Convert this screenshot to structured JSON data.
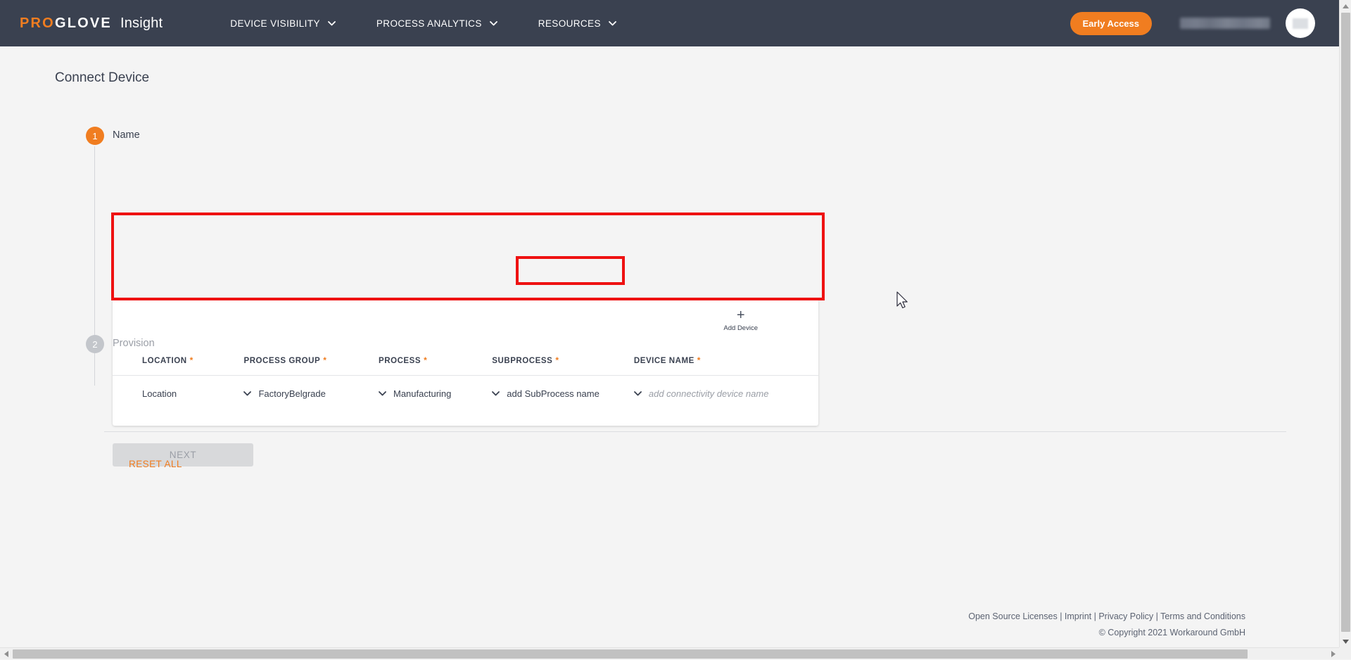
{
  "header": {
    "logo": {
      "pro": "PRO",
      "glove": "GLOVE",
      "product": "Insight"
    },
    "nav": [
      {
        "label": "DEVICE VISIBILITY",
        "icon": "chevron-down-icon"
      },
      {
        "label": "PROCESS ANALYTICS",
        "icon": "chevron-down-icon"
      },
      {
        "label": "RESOURCES",
        "icon": "chevron-down-icon"
      }
    ],
    "early_access_label": "Early Access",
    "avatar": "avatar"
  },
  "page": {
    "title": "Connect Device"
  },
  "steps": [
    {
      "number": "1",
      "label": "Name",
      "state": "active"
    },
    {
      "number": "2",
      "label": "Provision",
      "state": "inactive"
    }
  ],
  "card": {
    "add_device": {
      "plus": "+",
      "label": "Add Device"
    },
    "columns": [
      {
        "label": "LOCATION",
        "required": "*"
      },
      {
        "label": "PROCESS GROUP",
        "required": "*"
      },
      {
        "label": "PROCESS",
        "required": "*"
      },
      {
        "label": "SUBPROCESS",
        "required": "*"
      },
      {
        "label": "DEVICE NAME",
        "required": "*"
      }
    ],
    "rows": [
      {
        "location": {
          "value": "Location",
          "placeholder": false,
          "has_chevron": false
        },
        "process_group": {
          "value": "FactoryBelgrade",
          "placeholder": false,
          "has_chevron": true
        },
        "process": {
          "value": "Manufacturing",
          "placeholder": false,
          "has_chevron": true
        },
        "subprocess": {
          "value": "add SubProcess name",
          "placeholder": false,
          "has_chevron": true
        },
        "device_name": {
          "value": "add connectivity device name",
          "placeholder": true,
          "has_chevron": true
        }
      }
    ]
  },
  "actions": {
    "next_label": "NEXT",
    "reset_all_label": "RESET ALL"
  },
  "footer": {
    "links": [
      "Open Source Licenses",
      "Imprint",
      "Privacy Policy",
      "Terms and Conditions"
    ],
    "separator": " | ",
    "copyright": "© Copyright 2021 Workaround GmbH"
  },
  "colors": {
    "brand_orange": "#f07d20",
    "header_dark": "#3a4150",
    "annotation_red": "#ee1111",
    "page_bg": "#f4f4f4"
  }
}
